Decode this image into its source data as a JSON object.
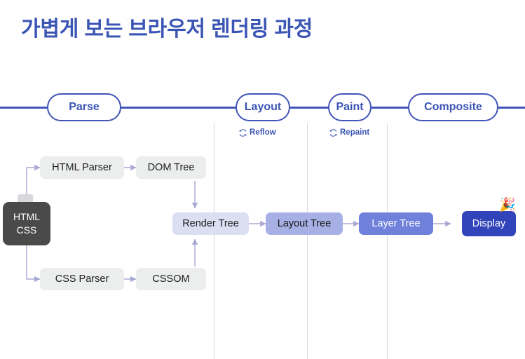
{
  "page": {
    "title": "가볍게 보는 브라우저 렌더링 과정",
    "accent_color": "#3b55b5",
    "rail_color": "#4155b7",
    "background": "#ffffff"
  },
  "pipeline": {
    "stages": [
      {
        "label": "Parse",
        "color": "#3b55b5"
      },
      {
        "label": "Layout",
        "color": "#3b55b5"
      },
      {
        "label": "Paint",
        "color": "#3b55b5"
      },
      {
        "label": "Composite",
        "color": "#3b55b5"
      }
    ],
    "sublabels": [
      {
        "label": "Reflow",
        "icon": "refresh-icon"
      },
      {
        "label": "Repaint",
        "icon": "refresh-icon"
      }
    ]
  },
  "source": {
    "line1": "HTML",
    "line2": "CSS",
    "color": "#4a4a4a",
    "icon": "document-tab-icon"
  },
  "flow": {
    "nodes": [
      {
        "id": "html-parser",
        "label": "HTML Parser",
        "style": "gray",
        "color": "#eceded"
      },
      {
        "id": "dom-tree",
        "label": "DOM Tree",
        "style": "gray",
        "color": "#eceded"
      },
      {
        "id": "css-parser",
        "label": "CSS Parser",
        "style": "gray",
        "color": "#eceded"
      },
      {
        "id": "cssom",
        "label": "CSSOM",
        "style": "gray",
        "color": "#eceded"
      },
      {
        "id": "render-tree",
        "label": "Render Tree",
        "style": "lav",
        "color": "#dcdef2"
      },
      {
        "id": "layout-tree",
        "label": "Layout Tree",
        "style": "mid",
        "color": "#a7b0e4"
      },
      {
        "id": "layer-tree",
        "label": "Layer Tree",
        "style": "strong",
        "color": "#6f81db"
      },
      {
        "id": "display",
        "label": "Display",
        "style": "deep",
        "color": "#3144b9"
      }
    ],
    "display_emoji": "🎉",
    "arrow_color": "#a9a9d4"
  }
}
